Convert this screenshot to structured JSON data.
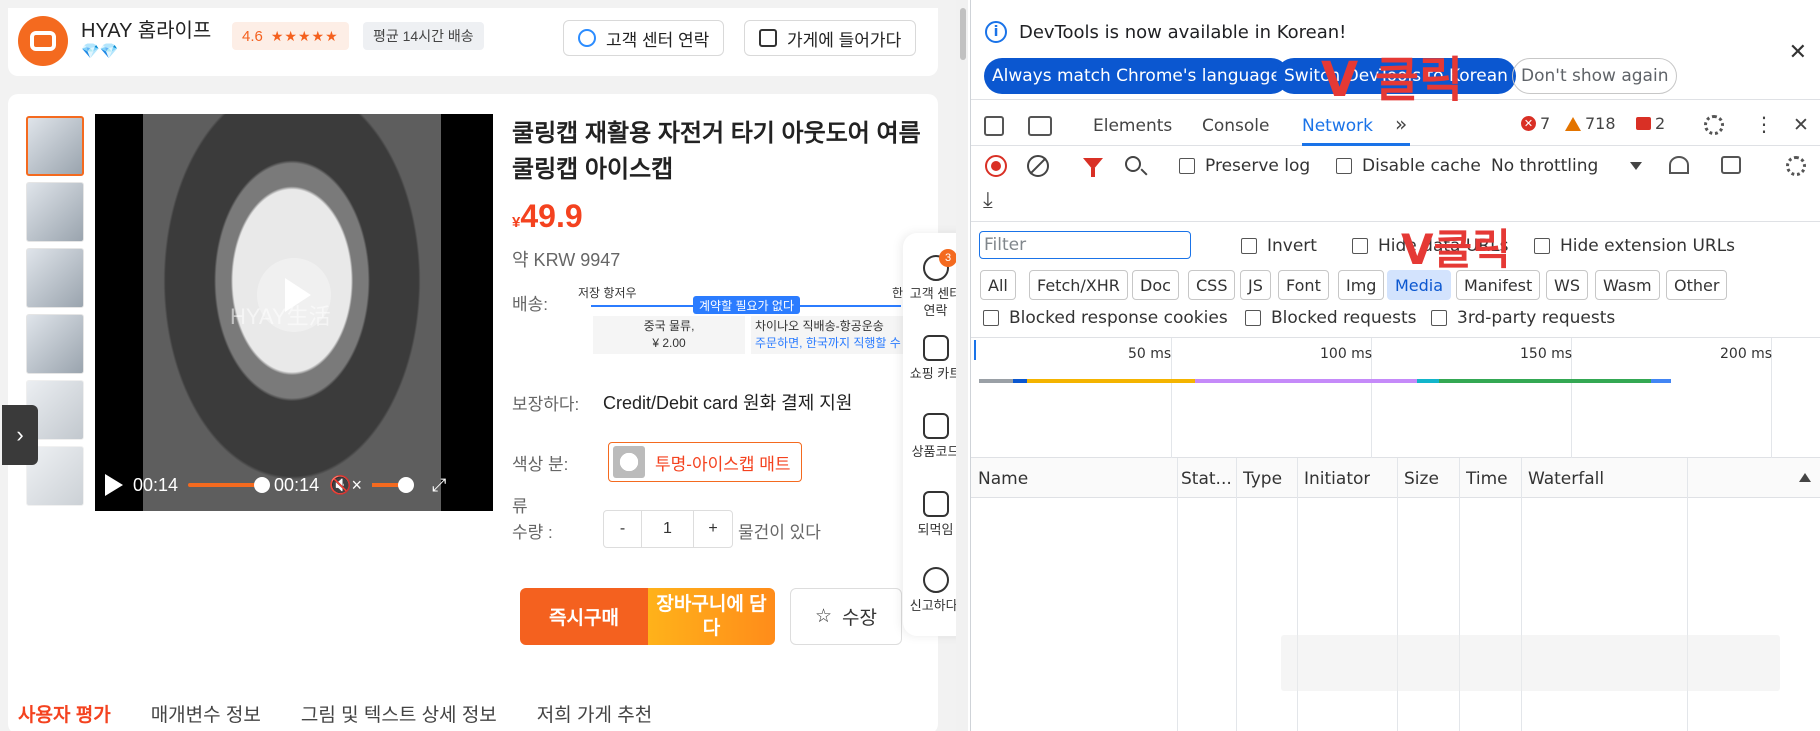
{
  "shop": {
    "name": "HYAY 홈라이프",
    "gems": "💎💎",
    "rating": "4.6",
    "stars": "★★★★★",
    "shipping": "평균 14시간 배송",
    "contact_btn": "고객 센터 연락",
    "store_btn": "가게에 들어가다"
  },
  "product": {
    "title": "쿨링캡 재활용 자전거 타기 아웃도어 여름 쿨링캡 아이스캡",
    "price_symbol": "¥",
    "price": "49.9",
    "krw": "약 KRW 9947",
    "delivery_label": "배송:",
    "route_from": "저장 항저우",
    "route_badge": "계약할 필요가 없다",
    "route_to": "한국",
    "route_box1_line1": "중국 물류,",
    "route_box1_line2": "¥ 2.00",
    "route_box2_line1": "차이나오 직배송-항공운송",
    "route_box2_line2": "주문하면, 한국까지 직행할 수",
    "guarantee_label": "보장하다:",
    "guarantee_value": "Credit/Debit card 원화 결제 지원",
    "color_label": "색상   분:",
    "color_label2": "류",
    "color_value": "투명-아이스캡 매트",
    "qty_label": "수량       :",
    "qty_minus": "-",
    "qty_value": "1",
    "qty_plus": "+",
    "stock": "물건이 있다",
    "buy_btn": "즉시구매",
    "cart_btn": "장바구니에 담다",
    "fav_btn": "수장",
    "fav_icon": "☆"
  },
  "video": {
    "watermark": "HYAY生活",
    "time_current": "00:14",
    "time_total": "00:14",
    "progress": 1.0,
    "volume_icon": "🔇×",
    "expand_icon": "⤢"
  },
  "tabs": [
    "사용자 평가",
    "매개변수 정보",
    "그림 및 텍스트 상세 정보",
    "저희 가게 추천"
  ],
  "floatbar": {
    "badge": "3",
    "item1": "고객 센터 연락",
    "item2": "쇼핑 카트",
    "item3": "상품코드",
    "item4": "되먹임",
    "item5": "신고하다."
  },
  "left_arrow": "›",
  "devtools": {
    "notice": "DevTools is now available in Korean!",
    "btn_match": "Always match Chrome's language",
    "btn_switch": "Switch DevTools to Korean",
    "btn_dont": "Don't show again",
    "close": "✕",
    "anno1": "V 클릭",
    "anno2": "V클릭",
    "tabs": {
      "elements": "Elements",
      "console": "Console",
      "network": "Network",
      "more": "»"
    },
    "errors": "7",
    "warnings": "718",
    "issues": "2",
    "kebab": "⋮",
    "tab_close": "✕",
    "preserve_log": "Preserve log",
    "disable_cache": "Disable cache",
    "throttling": "No throttling",
    "download": "⤓",
    "filter_placeholder": "Filter",
    "invert": "Invert",
    "hide_data": "Hide data URLs",
    "hide_ext": "Hide extension URLs",
    "chips": [
      "All",
      "Fetch/XHR",
      "Doc",
      "CSS",
      "JS",
      "Font",
      "Img",
      "Media",
      "Manifest",
      "WS",
      "Wasm",
      "Other"
    ],
    "selected_chip": "Media",
    "blocked_cookies": "Blocked response cookies",
    "blocked_requests": "Blocked requests",
    "third_party": "3rd-party requests",
    "timeline_labels": [
      "50 ms",
      "100 ms",
      "150 ms",
      "200 ms"
    ],
    "columns": [
      "Name",
      "Stat...",
      "Type",
      "Initiator",
      "Size",
      "Time",
      "Waterfall"
    ]
  },
  "colors": {
    "accent_orange": "#f4611f",
    "price_red": "#f4421f",
    "devtools_blue": "#1a73e8",
    "annotation_red": "#e53935"
  }
}
